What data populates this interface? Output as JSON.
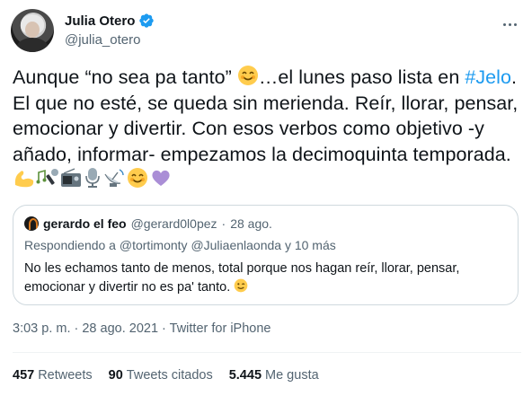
{
  "author": {
    "display_name": "Julia Otero",
    "handle": "@julia_otero"
  },
  "tweet": {
    "text_before_emoji1": "Aunque  “no sea pa tanto” ",
    "text_after_emoji1": "…el lunes paso lista en ",
    "hashtag": "#Jelo",
    "text_after_hashtag": ". El que no esté, se queda sin merienda. Reír, llorar, pensar, emocionar y divertir.  Con esos verbos como objetivo -y añado, informar- empezamos la decimoquinta temporada. ",
    "emojis": [
      "smiling-face-icon",
      "flexed-biceps-icon",
      "musical-note-mic-icon",
      "radio-icon",
      "studio-microphone-icon",
      "satellite-dish-icon",
      "smiling-face-icon",
      "purple-heart-icon"
    ]
  },
  "quote": {
    "name": "gerardo el feo",
    "handle": "@gerard0l0pez",
    "date": "28 ago.",
    "reply_prefix": "Respondiendo a ",
    "reply_mentions": "@tortimonty @Juliaenlaonda y 10 más",
    "text": "No les echamos tanto de menos, total porque nos hagan reír, llorar, pensar, emocionar y divertir no es pa' tanto. "
  },
  "meta": {
    "timestamp": "3:03 p. m. · 28 ago. 2021 · Twitter for iPhone"
  },
  "stats": {
    "retweets_count": "457",
    "retweets_label": "Retweets",
    "quotes_count": "90",
    "quotes_label": "Tweets citados",
    "likes_count": "5.445",
    "likes_label": "Me gusta"
  },
  "colors": {
    "link": "#1d9bf0",
    "secondary_text": "#536471",
    "border": "#cfd9de"
  }
}
